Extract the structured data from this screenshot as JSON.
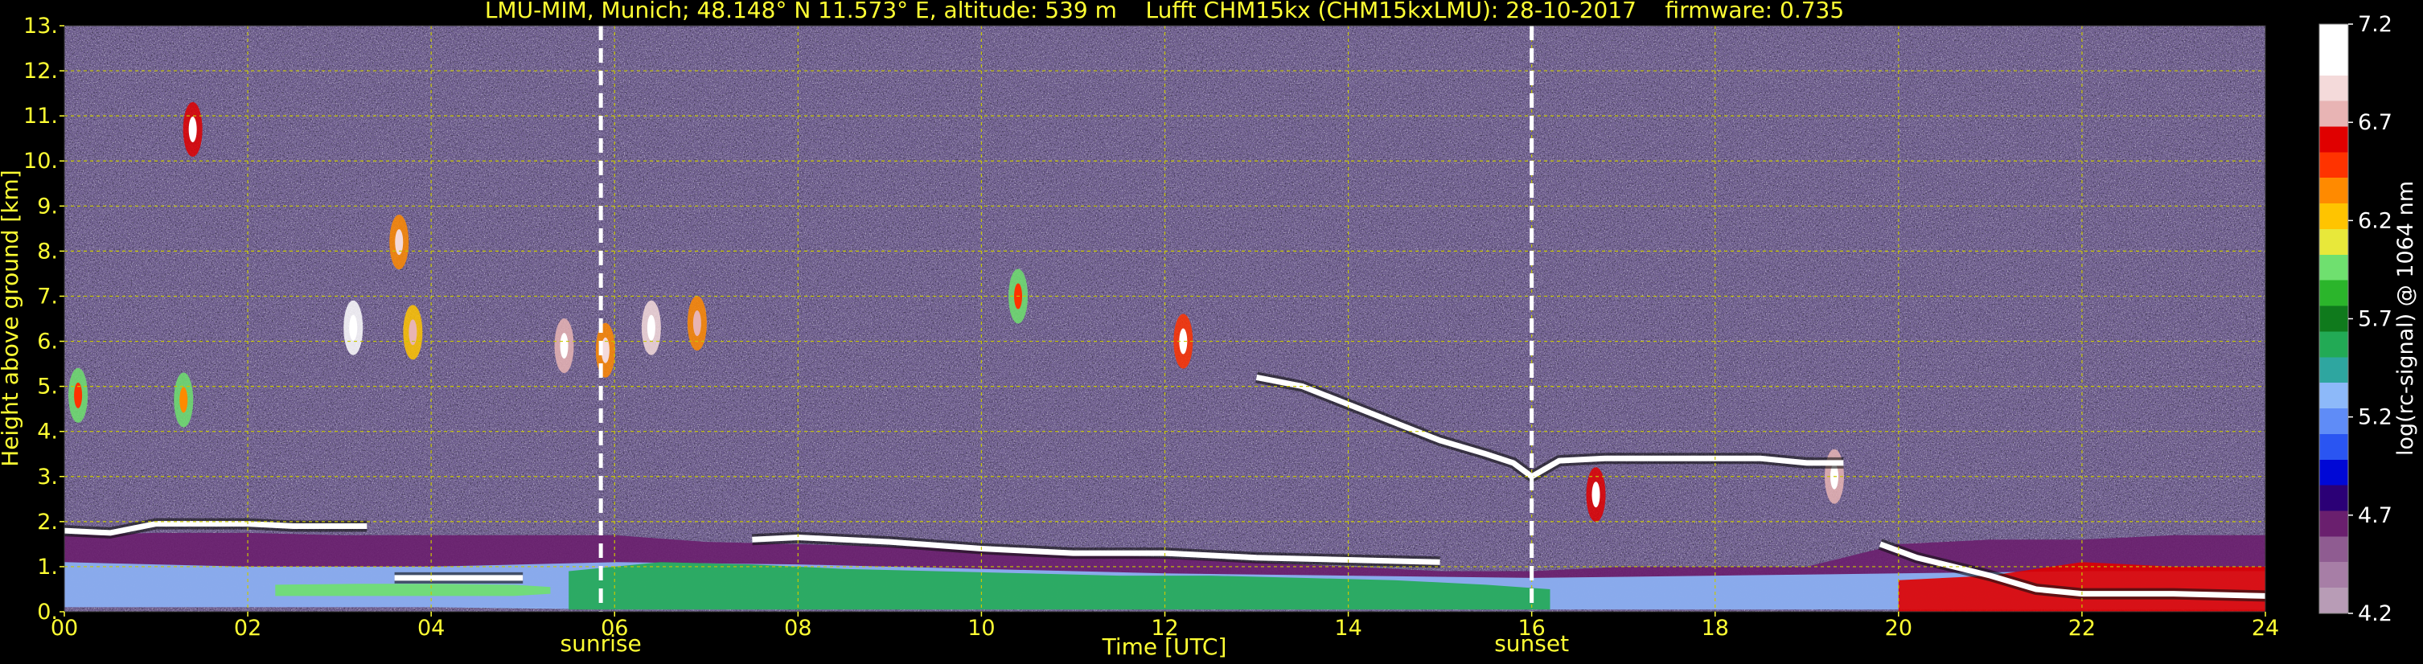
{
  "colors": {
    "background": "#000000",
    "text_axis": "#ffff33",
    "text_colorbar": "#ffffff",
    "grid": "#c8c800",
    "marker": "#ffffff"
  },
  "chart_data": {
    "type": "heatmap",
    "title": "LMU-MIM, Munich; 48.148° N 11.573° E, altitude: 539 m    Lufft CHM15kx (CHM15kxLMU): 28-10-2017    firmware: 0.735",
    "xlabel": "Time [UTC]",
    "ylabel": "Height above ground [km]",
    "xlim": [
      0,
      24
    ],
    "ylim": [
      0,
      13
    ],
    "x_ticks": [
      0,
      2,
      4,
      6,
      8,
      10,
      12,
      14,
      16,
      18,
      20,
      22,
      24
    ],
    "x_tick_labels": [
      "00",
      "02",
      "04",
      "06",
      "08",
      "10",
      "12",
      "14",
      "16",
      "18",
      "20",
      "22",
      "24"
    ],
    "y_ticks": [
      0,
      1,
      2,
      3,
      4,
      5,
      6,
      7,
      8,
      9,
      10,
      11,
      12,
      13
    ],
    "y_tick_labels": [
      "0.",
      "1.",
      "2.",
      "3.",
      "4.",
      "5.",
      "6.",
      "7.",
      "8.",
      "9.",
      "10.",
      "11.",
      "12.",
      "13."
    ],
    "grid": true,
    "events": [
      {
        "label": "sunrise",
        "time": 5.85
      },
      {
        "label": "sunset",
        "time": 16.0
      }
    ],
    "colorbar": {
      "label": "log(rc-signal) @ 1064 nm",
      "range": [
        4.2,
        7.2
      ],
      "ticks": [
        4.2,
        4.7,
        5.2,
        5.7,
        6.2,
        6.7,
        7.2
      ],
      "tick_labels": [
        "4.2",
        "4.7",
        "5.2",
        "5.7",
        "6.2",
        "6.7",
        "7.2"
      ],
      "colors": [
        "#b89cb6",
        "#a77ea6",
        "#8f5c91",
        "#6a1f6e",
        "#2b0076",
        "#0008d6",
        "#2a55f2",
        "#5f8cf7",
        "#8db9f9",
        "#2ea6a0",
        "#22aa55",
        "#0f7a1c",
        "#2bb52b",
        "#6fe06f",
        "#e8e83a",
        "#ffc400",
        "#ff8a00",
        "#ff3300",
        "#e00000",
        "#e8b4b4",
        "#f4dada",
        "#ffffff",
        "#ffffff"
      ]
    },
    "layers": [
      {
        "feature": "boundary layer",
        "x": [
          0,
          1,
          2,
          3,
          4,
          5,
          6,
          7,
          8,
          9,
          10,
          11,
          12,
          13,
          14,
          15,
          16,
          17,
          18,
          19,
          20,
          21,
          22,
          23,
          24
        ],
        "base": [
          0.1,
          0.1,
          0.1,
          0.1,
          0.1,
          0.1,
          0.05,
          0.05,
          0.05,
          0.05,
          0.05,
          0.05,
          0.05,
          0.05,
          0.05,
          0.05,
          0.05,
          0.05,
          0.05,
          0.05,
          0.05,
          0.05,
          0.05,
          0.05,
          0.05
        ],
        "top": [
          1.7,
          1.75,
          1.75,
          1.7,
          1.7,
          1.7,
          1.7,
          1.55,
          1.5,
          1.45,
          1.4,
          1.3,
          1.2,
          1.1,
          1.0,
          0.9,
          0.9,
          1.0,
          1.0,
          1.0,
          1.5,
          1.6,
          1.6,
          1.7,
          1.7
        ],
        "value": 4.7
      },
      {
        "feature": "residual layer",
        "x": [
          0,
          2,
          4,
          6,
          8,
          10,
          12,
          14,
          16,
          18,
          20,
          22,
          24
        ],
        "base": [
          0.1,
          0.1,
          0.1,
          0.05,
          0.05,
          0.05,
          0.05,
          0.05,
          0.05,
          0.05,
          0.05,
          0.05,
          0.05
        ],
        "top": [
          1.1,
          1.0,
          1.0,
          1.1,
          1.05,
          0.95,
          0.85,
          0.8,
          0.75,
          0.8,
          0.85,
          0.9,
          0.9
        ],
        "value": 5.3
      },
      {
        "feature": "mixed layer",
        "x": [
          5.5,
          6.5,
          7.5,
          8.5,
          9.5,
          10.5,
          11.5,
          12.5,
          13.5,
          14.5,
          15.5,
          16.2
        ],
        "base": [
          0.05,
          0.05,
          0.05,
          0.05,
          0.05,
          0.05,
          0.05,
          0.05,
          0.05,
          0.05,
          0.05,
          0.05
        ],
        "top": [
          0.9,
          1.1,
          1.05,
          0.95,
          0.9,
          0.85,
          0.8,
          0.8,
          0.75,
          0.7,
          0.6,
          0.5
        ],
        "value": 5.6
      },
      {
        "feature": "nocturnal surface layer",
        "x": [
          2.3,
          3.2,
          4.1,
          4.9,
          5.3
        ],
        "base": [
          0.35,
          0.35,
          0.35,
          0.35,
          0.4
        ],
        "top": [
          0.6,
          0.62,
          0.62,
          0.6,
          0.55
        ],
        "value": 6.0
      },
      {
        "feature": "late surface layer",
        "x": [
          20,
          21,
          22,
          23,
          24
        ],
        "base": [
          0.0,
          0.0,
          0.0,
          0.0,
          0.0
        ],
        "top": [
          0.7,
          0.8,
          1.1,
          1.0,
          1.0
        ],
        "value": 6.6
      }
    ],
    "lines": [
      {
        "feature": "boundary layer top",
        "x": [
          0,
          0.5,
          1,
          1.5,
          2,
          2.5,
          3,
          3.3
        ],
        "y": [
          1.8,
          1.75,
          1.95,
          1.95,
          1.95,
          1.9,
          1.9,
          1.9
        ],
        "value": 7.2
      },
      {
        "feature": "boundary layer top",
        "x": [
          7.5,
          8,
          9,
          10,
          11,
          12,
          13,
          14,
          15
        ],
        "y": [
          1.6,
          1.65,
          1.55,
          1.4,
          1.3,
          1.3,
          1.2,
          1.15,
          1.1
        ],
        "value": 7.1
      },
      {
        "feature": "descending cloud layer",
        "x": [
          13.0,
          13.5,
          14.0,
          14.5,
          15.0,
          15.5,
          15.8,
          16.0,
          16.3,
          16.8,
          17.5,
          18.0,
          18.5,
          19.0,
          19.4
        ],
        "y": [
          5.2,
          5.0,
          4.6,
          4.2,
          3.8,
          3.5,
          3.3,
          3.0,
          3.35,
          3.4,
          3.4,
          3.4,
          3.4,
          3.3,
          3.3
        ],
        "value": 7.2
      },
      {
        "feature": "nocturnal layer top",
        "x": [
          3.6,
          4.0,
          4.5,
          5.0
        ],
        "y": [
          0.75,
          0.75,
          0.75,
          0.75
        ],
        "value": 7.2
      },
      {
        "feature": "evening layer",
        "x": [
          19.8,
          20.2,
          20.6,
          21.0,
          21.5,
          22.0,
          23.0,
          24.0
        ],
        "y": [
          1.5,
          1.2,
          1.0,
          0.8,
          0.5,
          0.4,
          0.4,
          0.35
        ],
        "value": 7.2
      }
    ],
    "patches": [
      {
        "x": 0.15,
        "y": 4.8,
        "value": 6.0
      },
      {
        "x": 1.3,
        "y": 4.7,
        "value": 5.9
      },
      {
        "x": 3.15,
        "y": 6.3,
        "value": 7.2
      },
      {
        "x": 3.65,
        "y": 8.2,
        "value": 6.4
      },
      {
        "x": 3.8,
        "y": 6.2,
        "value": 6.2
      },
      {
        "x": 5.45,
        "y": 5.9,
        "value": 6.7
      },
      {
        "x": 5.9,
        "y": 5.8,
        "value": 6.4
      },
      {
        "x": 6.4,
        "y": 6.3,
        "value": 6.9
      },
      {
        "x": 6.9,
        "y": 6.4,
        "value": 6.3
      },
      {
        "x": 10.4,
        "y": 7.0,
        "value": 6.0
      },
      {
        "x": 12.2,
        "y": 6.0,
        "value": 6.5
      },
      {
        "x": 16.7,
        "y": 2.6,
        "value": 6.6
      },
      {
        "x": 19.3,
        "y": 3.0,
        "value": 6.8
      },
      {
        "x": 1.4,
        "y": 10.7,
        "value": 6.6
      }
    ]
  }
}
